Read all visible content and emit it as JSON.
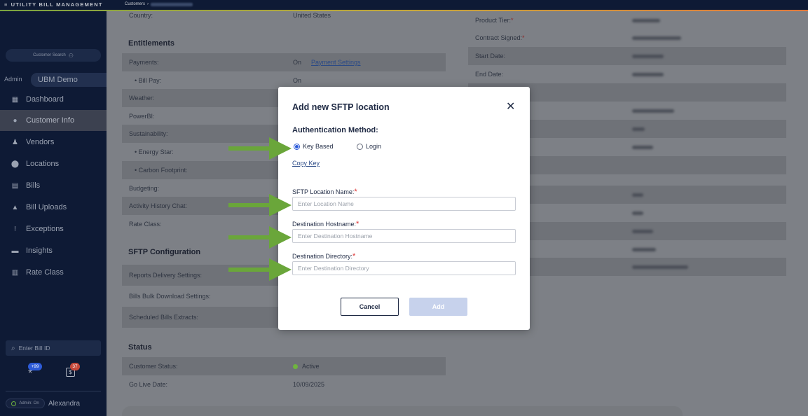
{
  "app": {
    "logo": "UTILITY BILL MANAGEMENT",
    "breadcrumb": "Customers"
  },
  "sidebar": {
    "customer_search": "Customer Search",
    "admin_label": "Admin",
    "client_name": "UBM Demo",
    "items": [
      {
        "label": "Dashboard",
        "icon": "dashboard-icon"
      },
      {
        "label": "Customer Info",
        "icon": "person-icon"
      },
      {
        "label": "Vendors",
        "icon": "vendor-icon"
      },
      {
        "label": "Locations",
        "icon": "location-pin-icon"
      },
      {
        "label": "Bills",
        "icon": "bill-icon"
      },
      {
        "label": "Bill Uploads",
        "icon": "upload-icon"
      },
      {
        "label": "Exceptions",
        "icon": "alert-icon"
      },
      {
        "label": "Insights",
        "icon": "insights-icon"
      },
      {
        "label": "Rate Class",
        "icon": "rate-class-icon"
      }
    ],
    "bill_search_placeholder": "Enter Bill ID",
    "badge_left": "+99",
    "badge_right": "37",
    "admin_toggle": "Admin: On",
    "user_name": "Alexandra"
  },
  "main": {
    "country_label": "Country:",
    "country_value": "United States",
    "entitlements_title": "Entitlements",
    "entitlements": [
      {
        "label": "Payments:",
        "value": "On",
        "link": "Payment Settings"
      },
      {
        "label": "• Bill Pay:",
        "value": "On"
      },
      {
        "label": "Weather:"
      },
      {
        "label": "PowerBI:"
      },
      {
        "label": "Sustainability:"
      },
      {
        "label": "• Energy Star:"
      },
      {
        "label": "• Carbon Footprint:"
      },
      {
        "label": "Budgeting:"
      },
      {
        "label": "Activity History Chat:"
      },
      {
        "label": "Rate Class:"
      }
    ],
    "sftp_title": "SFTP Configuration",
    "sftp_rows": [
      {
        "label": "Reports Delivery Settings:"
      },
      {
        "label": "Bills Bulk Download Settings:"
      },
      {
        "label": "Scheduled Bills Extracts:"
      }
    ],
    "status_title": "Status",
    "status_rows": [
      {
        "label": "Customer Status:",
        "value": "Active"
      },
      {
        "label": "Go Live Date:",
        "value": "10/09/2025"
      }
    ],
    "right_rows": [
      {
        "label": "Product Tier:",
        "required": "*"
      },
      {
        "label": "Contract Signed:",
        "required": "*"
      },
      {
        "label": "Start Date:"
      },
      {
        "label": "End Date:"
      }
    ]
  },
  "modal": {
    "title": "Add new SFTP location",
    "close": "✕",
    "auth_title": "Authentication Method:",
    "radio_key": "Key Based",
    "radio_login": "Login",
    "copy_key": "Copy Key",
    "name_label": "SFTP Location Name:",
    "name_placeholder": "Enter Location Name",
    "host_label": "Destination Hostname:",
    "host_placeholder": "Enter Destination Hostname",
    "dir_label": "Destination Directory:",
    "dir_placeholder": "Enter Destination Directory",
    "required_mark": "*",
    "cancel": "Cancel",
    "add": "Add"
  },
  "colors": {
    "arrow": "#6aa63a",
    "accent": "#2d5bd8",
    "active_status": "#6fb43f"
  }
}
